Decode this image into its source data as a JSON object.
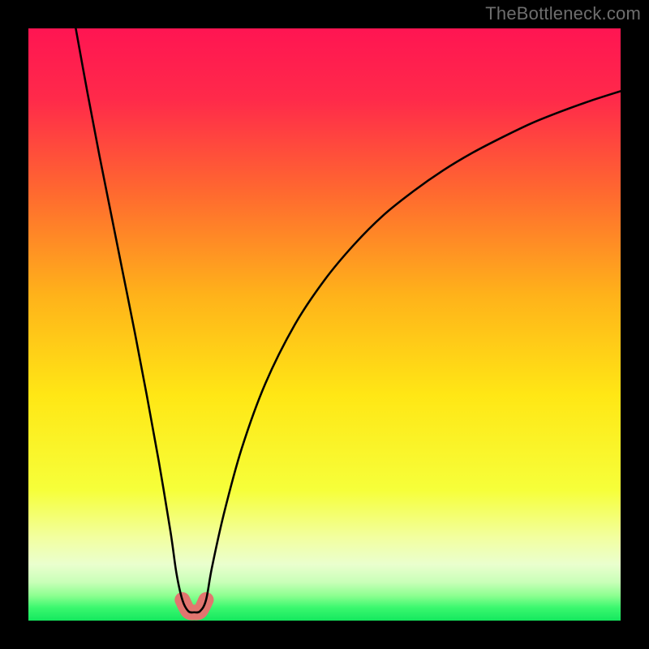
{
  "watermark": "TheBottleneck.com",
  "chart_data": {
    "type": "line",
    "title": "",
    "xlabel": "",
    "ylabel": "",
    "xlim": [
      0,
      100
    ],
    "ylim": [
      0,
      100
    ],
    "highlight_x_range": [
      25.5,
      30.5
    ],
    "series": [
      {
        "name": "curve",
        "x": [
          8,
          10,
          12,
          14,
          16,
          18,
          20,
          22,
          24,
          25,
          26,
          27,
          28,
          29,
          30,
          31,
          33,
          36,
          40,
          45,
          50,
          55,
          60,
          65,
          70,
          75,
          80,
          85,
          90,
          95,
          100
        ],
        "y": [
          100,
          89,
          78.5,
          68.5,
          58.5,
          48.5,
          38,
          27,
          15,
          8,
          3.5,
          1.6,
          1.4,
          1.6,
          3.5,
          9,
          18,
          29,
          40,
          50,
          57.5,
          63.5,
          68.5,
          72.5,
          76,
          79,
          81.6,
          84,
          86,
          87.8,
          89.4
        ]
      }
    ],
    "gradient_stops": [
      {
        "offset": 0,
        "color": "#ff1552"
      },
      {
        "offset": 0.12,
        "color": "#ff2a4a"
      },
      {
        "offset": 0.28,
        "color": "#ff6a2f"
      },
      {
        "offset": 0.45,
        "color": "#ffb21a"
      },
      {
        "offset": 0.62,
        "color": "#ffe715"
      },
      {
        "offset": 0.78,
        "color": "#f6ff3a"
      },
      {
        "offset": 0.86,
        "color": "#f2ffa0"
      },
      {
        "offset": 0.905,
        "color": "#eaffce"
      },
      {
        "offset": 0.935,
        "color": "#c9ffb8"
      },
      {
        "offset": 0.958,
        "color": "#8cff90"
      },
      {
        "offset": 0.978,
        "color": "#3bf86f"
      },
      {
        "offset": 1.0,
        "color": "#14e85e"
      }
    ],
    "highlight_color": "#e2756f",
    "curve_color": "#000000"
  }
}
